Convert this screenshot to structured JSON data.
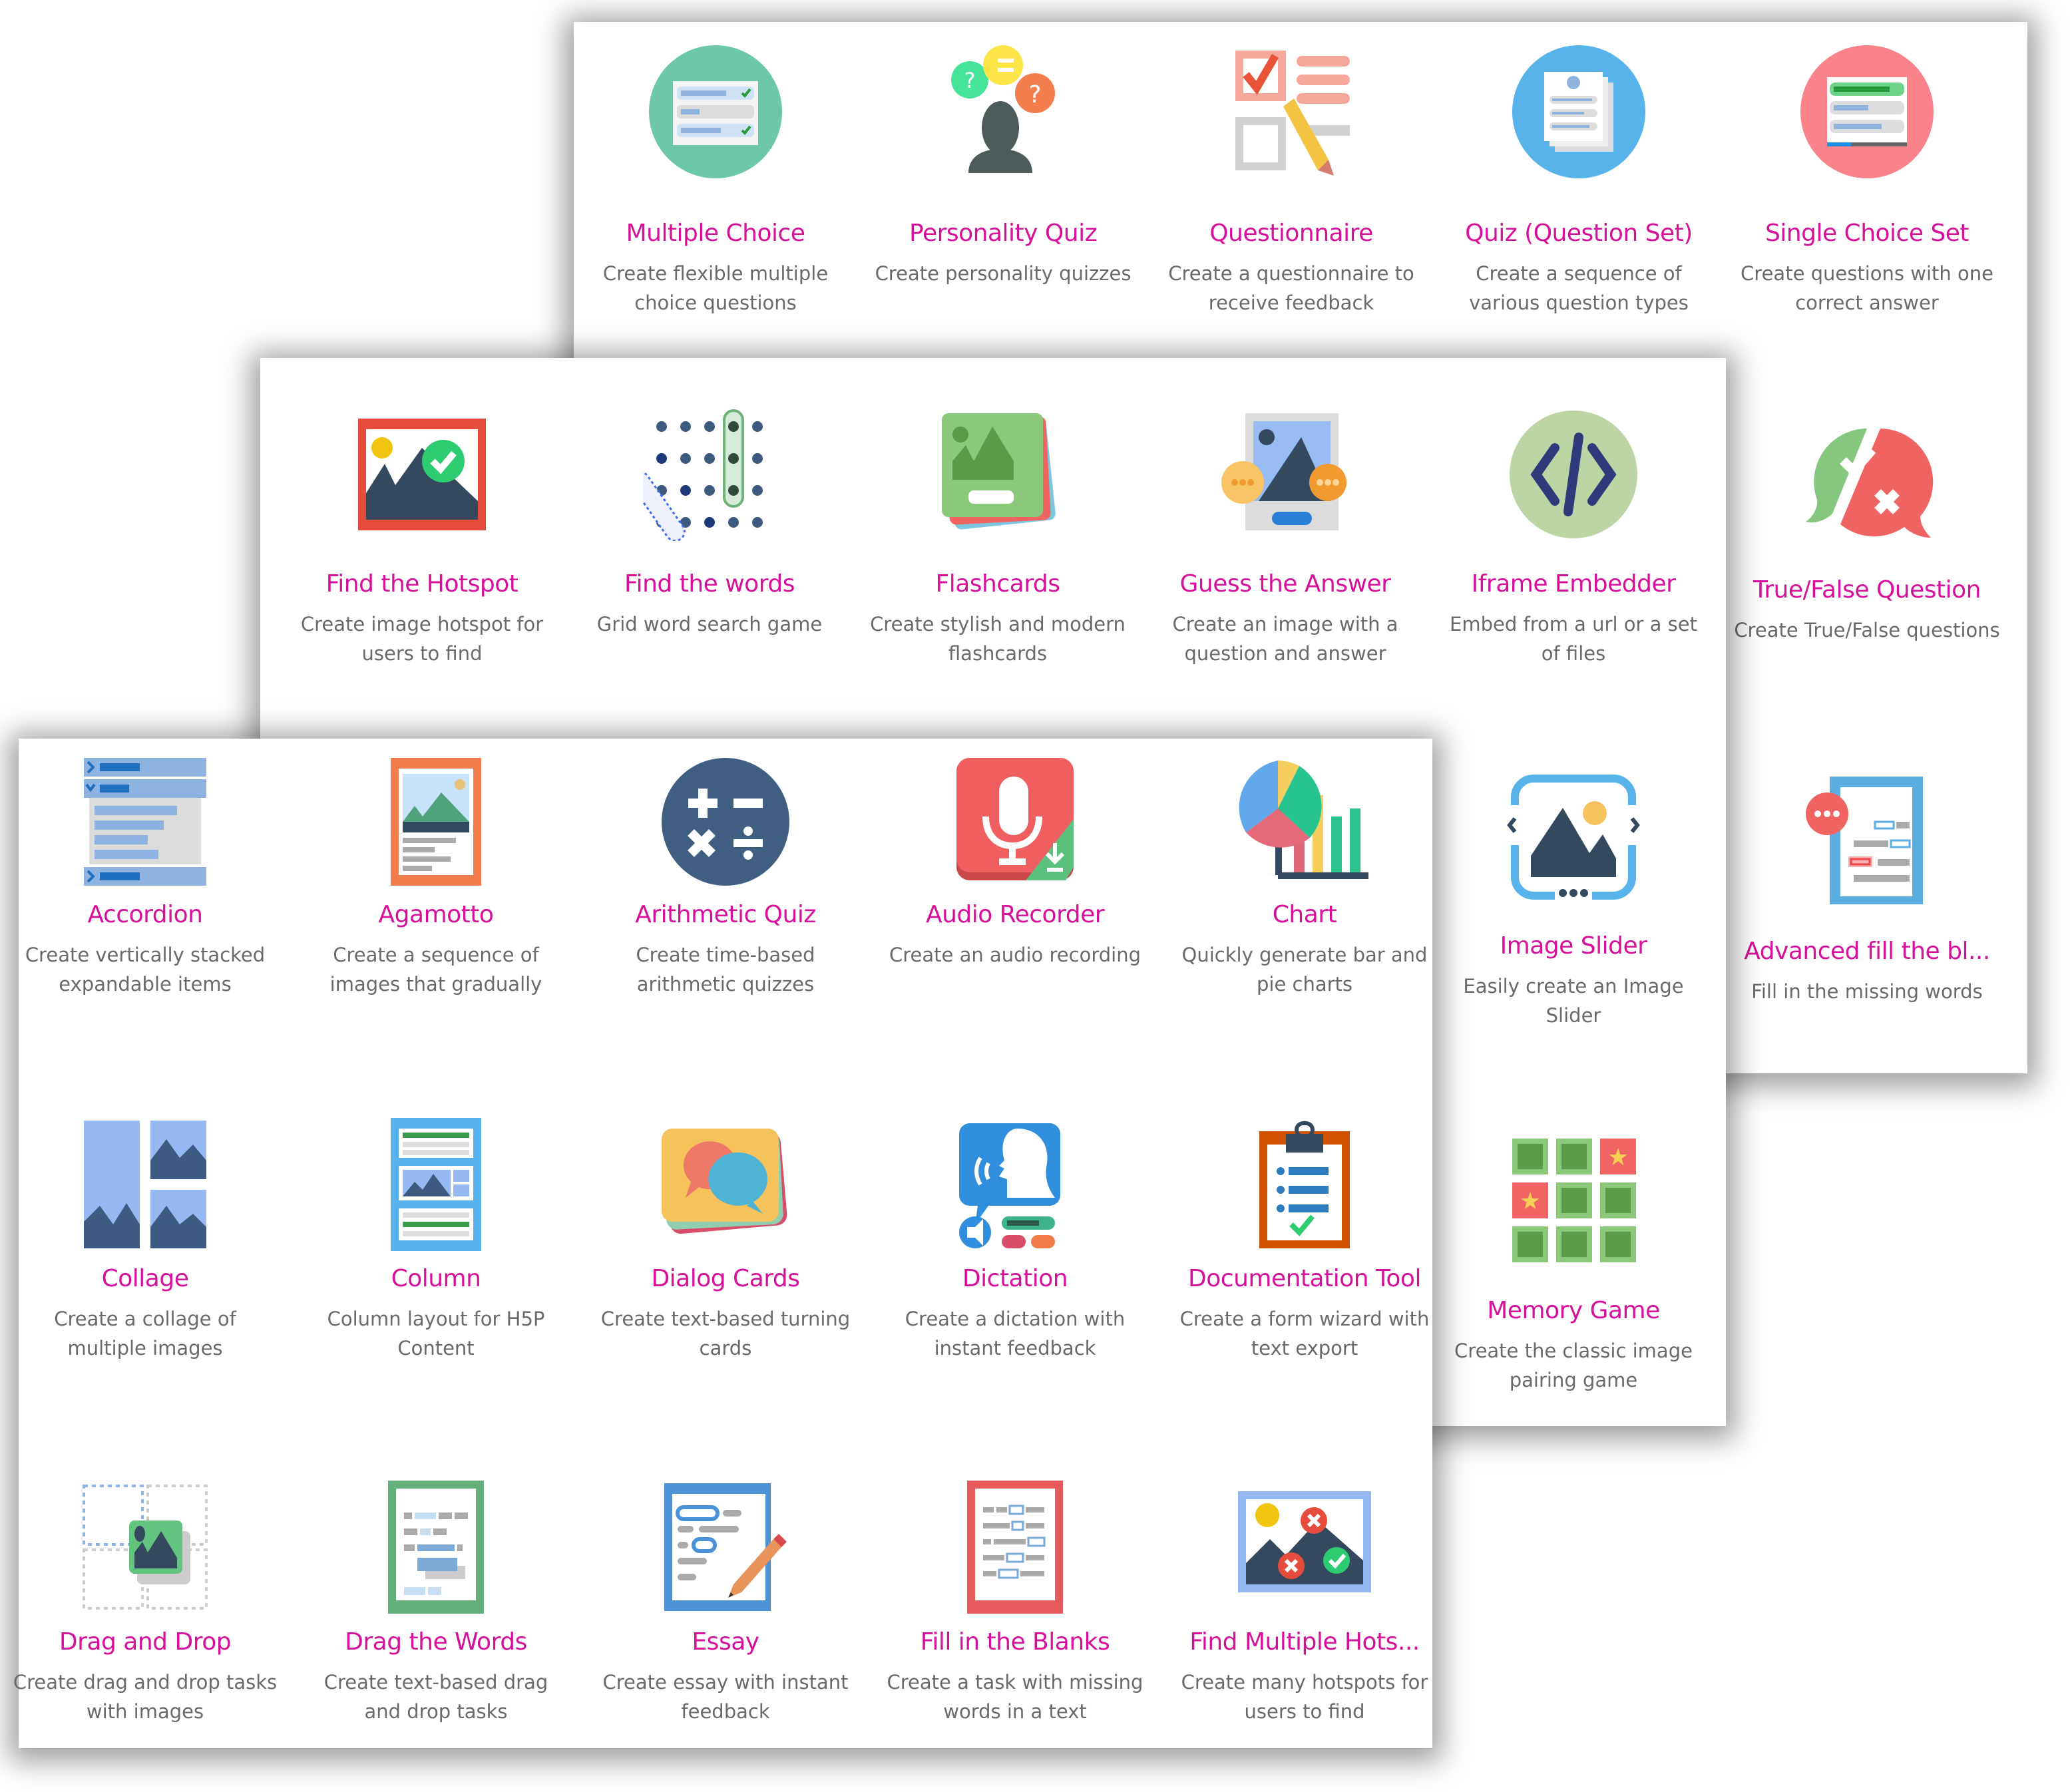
{
  "colors": {
    "title": "#d6109b",
    "description": "#6a6a6a",
    "panel": "#ffffff"
  },
  "panels": [
    {
      "name": "back-panel",
      "items": [
        {
          "title": "Multiple Choice",
          "desc": "Create flexible multiple choice questions",
          "icon": "multiple-choice-icon"
        },
        {
          "title": "Personality Quiz",
          "desc": "Create personality quizzes",
          "icon": "personality-quiz-icon"
        },
        {
          "title": "Questionnaire",
          "desc": "Create a questionnaire to receive feedback",
          "icon": "questionnaire-icon"
        },
        {
          "title": "Quiz (Question Set)",
          "desc": "Create a sequence of various question types",
          "icon": "question-set-icon"
        },
        {
          "title": "Single Choice Set",
          "desc": "Create questions with one correct answer",
          "icon": "single-choice-set-icon"
        },
        {
          "title": "True/False Question",
          "desc": "Create True/False questions",
          "icon": "true-false-icon"
        },
        {
          "title": "Advanced fill the bl...",
          "desc": "Fill in the missing words",
          "icon": "advanced-fill-blanks-icon"
        }
      ]
    },
    {
      "name": "middle-panel",
      "items": [
        {
          "title": "Find the Hotspot",
          "desc": "Create image hotspot for users to find",
          "icon": "find-hotspot-icon"
        },
        {
          "title": "Find the words",
          "desc": "Grid word search game",
          "icon": "find-words-icon"
        },
        {
          "title": "Flashcards",
          "desc": "Create stylish and modern flashcards",
          "icon": "flashcards-icon"
        },
        {
          "title": "Guess the Answer",
          "desc": "Create an image with a question and answer",
          "icon": "guess-answer-icon"
        },
        {
          "title": "Iframe Embedder",
          "desc": "Embed from a url or a set of files",
          "icon": "iframe-embedder-icon"
        },
        {
          "title": "Image Slider",
          "desc": "Easily create an Image Slider",
          "icon": "image-slider-icon"
        },
        {
          "title": "Memory Game",
          "desc": "Create the classic image pairing game",
          "icon": "memory-game-icon"
        }
      ]
    },
    {
      "name": "front-panel",
      "items": [
        {
          "title": "Accordion",
          "desc": "Create vertically stacked expandable items",
          "icon": "accordion-icon"
        },
        {
          "title": "Agamotto",
          "desc": "Create a sequence of images that gradually",
          "icon": "agamotto-icon"
        },
        {
          "title": "Arithmetic Quiz",
          "desc": "Create time-based arithmetic quizzes",
          "icon": "arithmetic-quiz-icon"
        },
        {
          "title": "Audio Recorder",
          "desc": "Create an audio recording",
          "icon": "audio-recorder-icon"
        },
        {
          "title": "Chart",
          "desc": "Quickly generate bar and pie charts",
          "icon": "chart-icon"
        },
        {
          "title": "Collage",
          "desc": "Create a collage of multiple images",
          "icon": "collage-icon"
        },
        {
          "title": "Column",
          "desc": "Column layout for H5P Content",
          "icon": "column-icon"
        },
        {
          "title": "Dialog Cards",
          "desc": "Create text-based turning cards",
          "icon": "dialog-cards-icon"
        },
        {
          "title": "Dictation",
          "desc": "Create a dictation with instant feedback",
          "icon": "dictation-icon"
        },
        {
          "title": "Documentation Tool",
          "desc": "Create a form wizard with text export",
          "icon": "documentation-tool-icon"
        },
        {
          "title": "Drag and Drop",
          "desc": "Create drag and drop tasks with images",
          "icon": "drag-and-drop-icon"
        },
        {
          "title": "Drag the Words",
          "desc": "Create text-based drag and drop tasks",
          "icon": "drag-the-words-icon"
        },
        {
          "title": "Essay",
          "desc": "Create essay with instant feedback",
          "icon": "essay-icon"
        },
        {
          "title": "Fill in the Blanks",
          "desc": "Create a task with missing words in a text",
          "icon": "fill-in-blanks-icon"
        },
        {
          "title": "Find Multiple Hots...",
          "desc": "Create many hotspots for users to find",
          "icon": "find-multiple-hotspots-icon"
        }
      ]
    }
  ]
}
